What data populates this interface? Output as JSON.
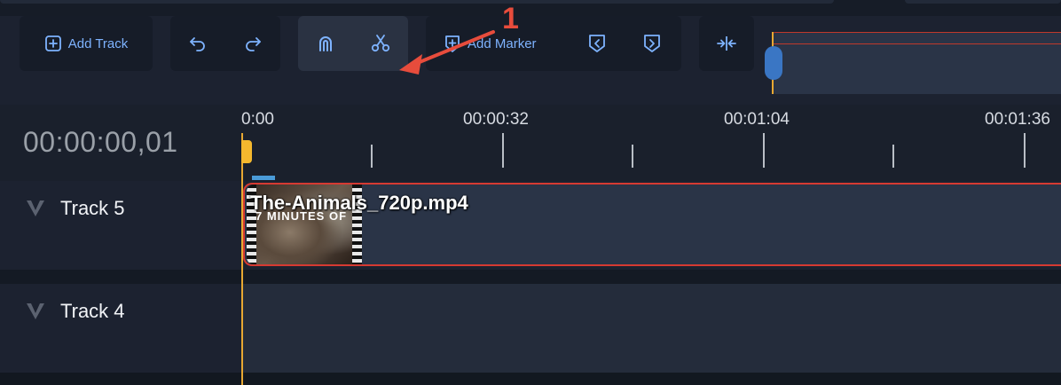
{
  "annotation": {
    "label": "1",
    "color": "#e74c3c"
  },
  "toolbar": {
    "add_track_label": "Add Track",
    "add_marker_label": "Add Marker",
    "undo_icon": "undo-icon",
    "redo_icon": "redo-icon",
    "magnet_icon": "magnet-icon",
    "cut_icon": "scissors-icon",
    "marker_prev_icon": "marker-prev-icon",
    "marker_next_icon": "marker-next-icon",
    "zoom_fit_icon": "zoom-fit-icon",
    "accent_color": "#7eb3ff"
  },
  "timeline": {
    "current_time": "00:00:00,01",
    "ruler_labels": [
      "0:00",
      "00:00:32",
      "00:01:04",
      "00:01:36"
    ],
    "playhead_color": "#f5b82e"
  },
  "tracks": [
    {
      "name": "Track 5",
      "clip": {
        "filename": "The-Animals_720p.mp4",
        "thumbnail_caption": "7 MINUTES OF"
      }
    },
    {
      "name": "Track 4"
    }
  ]
}
